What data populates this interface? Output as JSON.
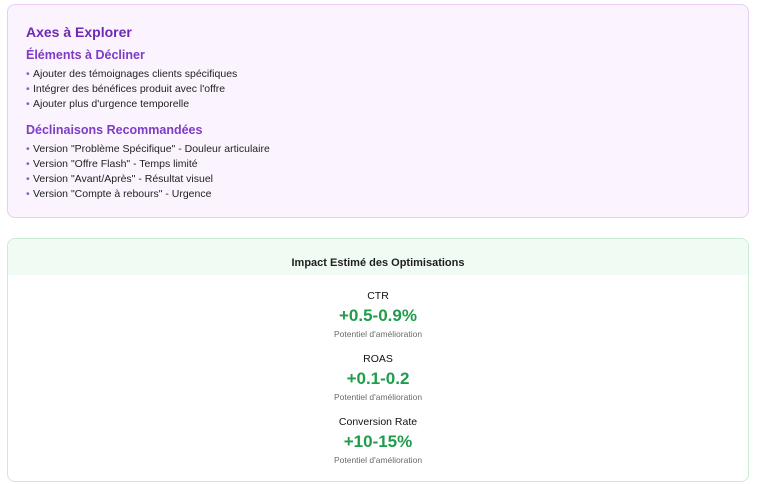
{
  "axes": {
    "title": "Axes à Explorer",
    "elements_section": {
      "title": "Éléments à Décliner",
      "items": [
        "Ajouter des témoignages clients spécifiques",
        "Intégrer des bénéfices produit avec l'offre",
        "Ajouter plus d'urgence temporelle"
      ]
    },
    "variants_section": {
      "title": "Déclinaisons Recommandées",
      "items": [
        "Version \"Problème Spécifique\" - Douleur articulaire",
        "Version \"Offre Flash\" - Temps limité",
        "Version \"Avant/Après\" - Résultat visuel",
        "Version \"Compte à rebours\" - Urgence"
      ]
    },
    "bullet_char": "•",
    "colors": {
      "background": "#fbf4fe",
      "border": "#e7cdf7",
      "title": "#6d28b5"
    }
  },
  "impact": {
    "title": "Impact Estimé des Optimisations",
    "metrics": [
      {
        "name": "CTR",
        "value": "+0.5-0.9%",
        "caption": "Potentiel d'amélioration"
      },
      {
        "name": "ROAS",
        "value": "+0.1-0.2",
        "caption": "Potentiel d'amélioration"
      },
      {
        "name": "Conversion Rate",
        "value": "+10-15%",
        "caption": "Potentiel d'amélioration"
      }
    ],
    "colors": {
      "header_background": "#f0fbf3",
      "border": "#c9ecd3",
      "value": "#1f9d4c"
    }
  }
}
